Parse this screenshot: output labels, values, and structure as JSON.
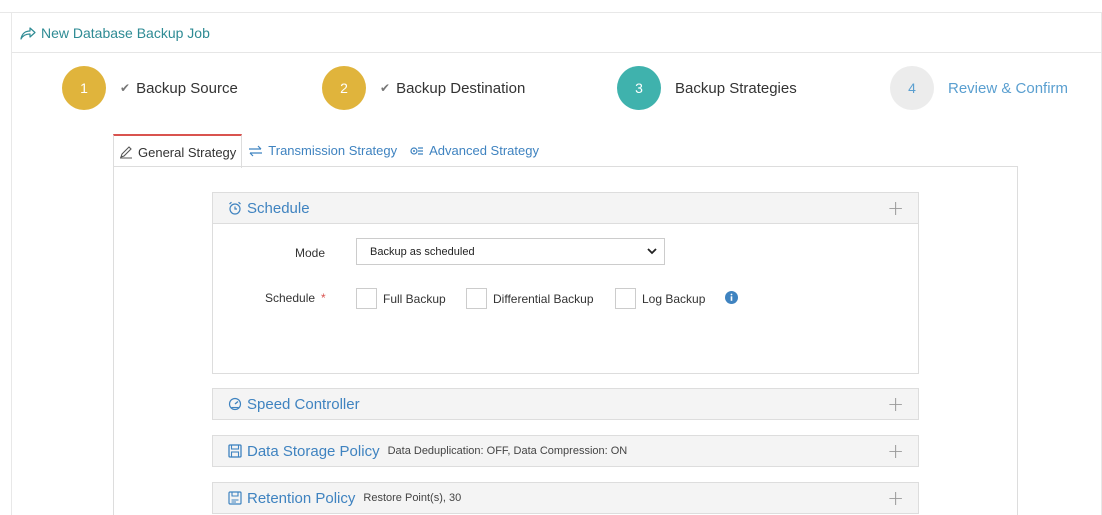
{
  "header": {
    "title": "New Database Backup Job",
    "icon": "share-arrow-icon"
  },
  "steps": [
    {
      "number": "1",
      "label": "Backup Source",
      "done": true,
      "color": "#e0b43c"
    },
    {
      "number": "2",
      "label": "Backup Destination",
      "done": true,
      "color": "#e0b43c"
    },
    {
      "number": "3",
      "label": "Backup Strategies",
      "done": false,
      "color": "#3fb2ad"
    },
    {
      "number": "4",
      "label": "Review & Confirm",
      "done": false,
      "color": "#ececec"
    }
  ],
  "tabs": [
    {
      "label": "General Strategy",
      "icon": "edit-icon",
      "active": true
    },
    {
      "label": "Transmission Strategy",
      "icon": "transfer-arrows-icon",
      "active": false
    },
    {
      "label": "Advanced Strategy",
      "icon": "gears-icon",
      "active": false
    }
  ],
  "panels": {
    "schedule": {
      "title": "Schedule",
      "icon": "alarm-clock-icon"
    },
    "speed": {
      "title": "Speed Controller",
      "icon": "speedometer-icon"
    },
    "storage": {
      "title": "Data Storage Policy",
      "subtitle": "Data Deduplication: OFF, Data Compression: ON",
      "icon": "floppy-disk-icon"
    },
    "retention": {
      "title": "Retention Policy",
      "subtitle": "Restore Point(s), 30",
      "icon": "retention-icon"
    }
  },
  "schedule_form": {
    "mode_label": "Mode",
    "mode_value": "Backup as scheduled",
    "schedule_label": "Schedule",
    "required_mark": "*",
    "options": [
      {
        "label": "Full Backup",
        "checked": false
      },
      {
        "label": "Differential Backup",
        "checked": false
      },
      {
        "label": "Log Backup",
        "checked": false
      }
    ]
  },
  "colors": {
    "accent": "#3f83c0",
    "teal": "#2e8b94",
    "done_step": "#e0b43c",
    "active_step": "#3fb2ad",
    "tab_active_border": "#d9534f"
  }
}
